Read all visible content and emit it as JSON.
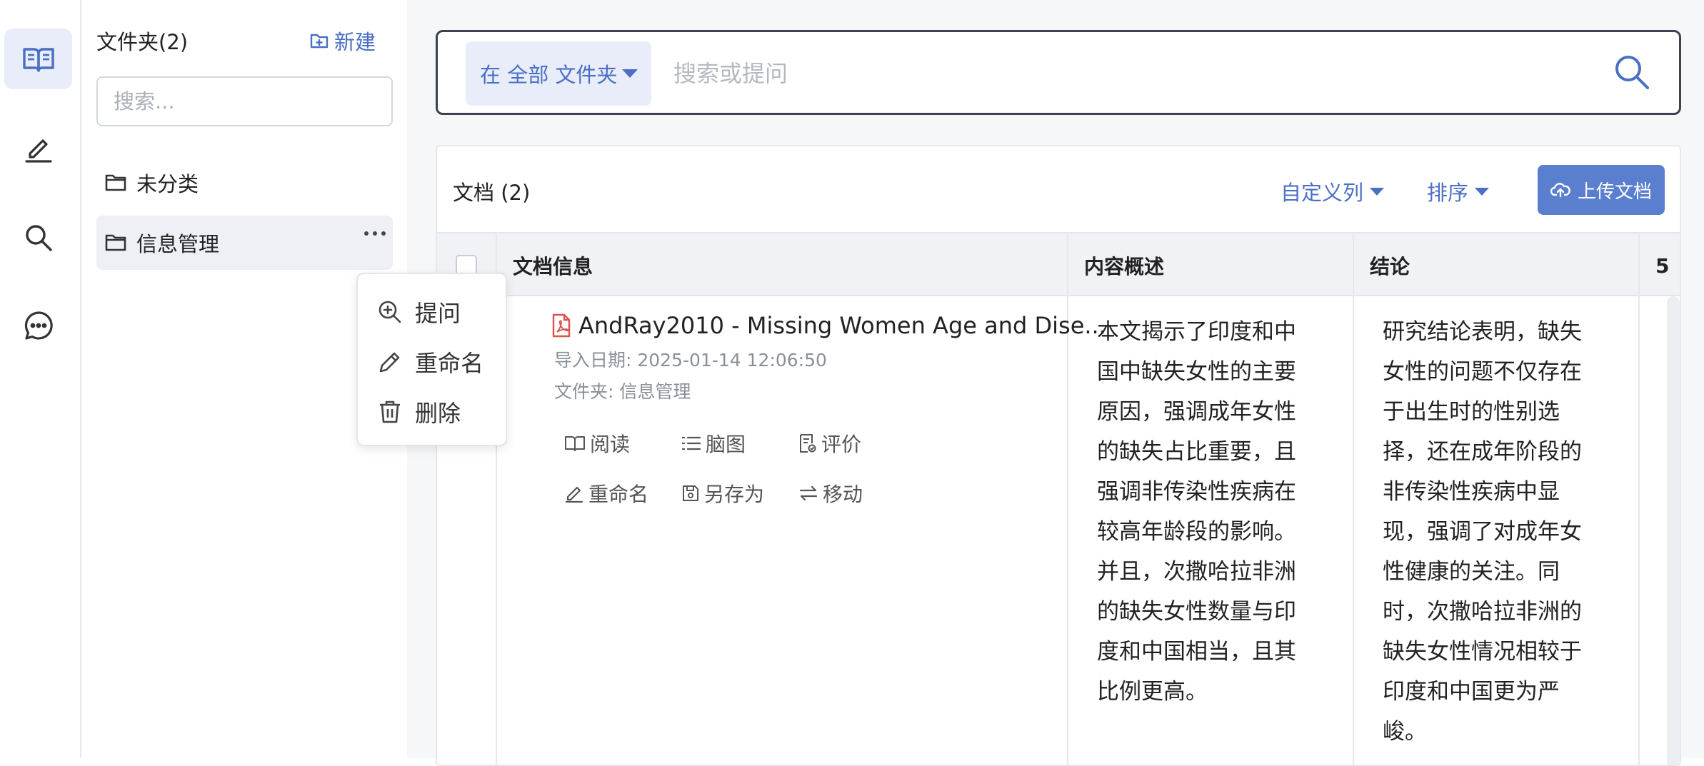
{
  "rail": {
    "items": [
      {
        "name": "library",
        "icon": "open-book-icon",
        "active": true
      },
      {
        "name": "notes",
        "icon": "pen-icon",
        "active": false
      },
      {
        "name": "search",
        "icon": "search-icon",
        "active": false
      },
      {
        "name": "chat",
        "icon": "chat-bubble-icon",
        "active": false
      }
    ]
  },
  "folders": {
    "title": "文件夹(2)",
    "new_label": "新建",
    "search_placeholder": "搜索...",
    "items": [
      {
        "label": "未分类",
        "active": false
      },
      {
        "label": "信息管理",
        "active": true
      }
    ]
  },
  "context_menu": {
    "items": [
      {
        "label": "提问",
        "icon": "zoom-in-icon"
      },
      {
        "label": "重命名",
        "icon": "pencil-icon"
      },
      {
        "label": "删除",
        "icon": "trash-icon"
      }
    ]
  },
  "search": {
    "scope_label": "在 全部 文件夹",
    "placeholder": "搜索或提问"
  },
  "documents": {
    "title": "文档 (2)",
    "custom_columns_label": "自定义列",
    "sort_label": "排序",
    "upload_label": "上传文档",
    "columns": [
      "文档信息",
      "内容概述",
      "结论",
      "5"
    ],
    "rows": [
      {
        "title": "AndRay2010 - Missing Women Age and Dise...",
        "imported": "导入日期: 2025-01-14 12:06:50",
        "folder": "文件夹: 信息管理",
        "actions": [
          "阅读",
          "脑图",
          "评价",
          "重命名",
          "另存为",
          "移动"
        ],
        "summary": "本文揭示了印度和中\n国中缺失女性的主要\n原因，强调成年女性\n的缺失占比重要，且\n强调非传染性疾病在\n较高年龄段的影响。\n并且，次撒哈拉非洲\n的缺失女性数量与印\n度和中国相当，且其\n比例更高。",
        "conclusion": "研究结论表明，缺失\n女性的问题不仅存在\n于出生时的性别选\n择，还在成年阶段的\n非传染性疾病中显\n现，强调了对成年女\n性健康的关注。同\n时，次撒哈拉非洲的\n缺失女性情况相较于\n印度和中国更为严\n峻。"
      }
    ]
  },
  "colors": {
    "accent": "#4a6fc4",
    "upload_button": "#5b7fcf",
    "active_bg": "#e8edf9",
    "pdf_red": "#d9534f"
  }
}
